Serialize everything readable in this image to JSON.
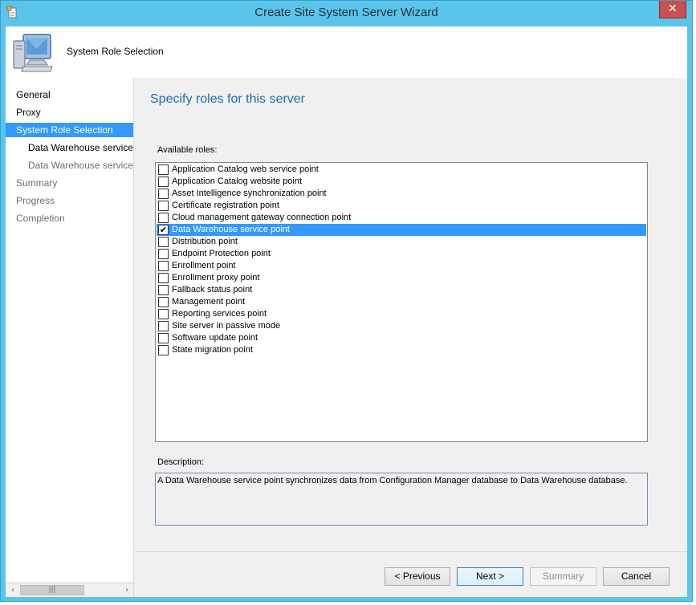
{
  "window": {
    "title": "Create Site System Server Wizard",
    "close_label": "✕"
  },
  "header": {
    "title": "System Role Selection"
  },
  "nav": {
    "items": [
      {
        "label": "General",
        "state": "normal"
      },
      {
        "label": "Proxy",
        "state": "normal"
      },
      {
        "label": "System Role Selection",
        "state": "active"
      },
      {
        "label": "Data Warehouse service point",
        "state": "sub"
      },
      {
        "label": "Data Warehouse service point",
        "state": "sub-disabled"
      },
      {
        "label": "Summary",
        "state": "disabled"
      },
      {
        "label": "Progress",
        "state": "disabled"
      },
      {
        "label": "Completion",
        "state": "disabled"
      }
    ],
    "scroll_left": "‹",
    "scroll_right": "›",
    "scroll_grip": "|||"
  },
  "main": {
    "page_title": "Specify roles for this server",
    "available_roles_label": "Available roles:",
    "roles": [
      {
        "label": "Application Catalog web service point",
        "checked": false
      },
      {
        "label": "Application Catalog website point",
        "checked": false
      },
      {
        "label": "Asset Intelligence synchronization point",
        "checked": false
      },
      {
        "label": "Certificate registration point",
        "checked": false
      },
      {
        "label": "Cloud management gateway connection point",
        "checked": false
      },
      {
        "label": "Data Warehouse service point",
        "checked": true,
        "selected": true
      },
      {
        "label": "Distribution point",
        "checked": false
      },
      {
        "label": "Endpoint Protection point",
        "checked": false
      },
      {
        "label": "Enrollment point",
        "checked": false
      },
      {
        "label": "Enrollment proxy point",
        "checked": false
      },
      {
        "label": "Fallback status point",
        "checked": false
      },
      {
        "label": "Management point",
        "checked": false
      },
      {
        "label": "Reporting services point",
        "checked": false
      },
      {
        "label": "Site server in passive mode",
        "checked": false
      },
      {
        "label": "Software update point",
        "checked": false
      },
      {
        "label": "State migration point",
        "checked": false
      }
    ],
    "description_label": "Description:",
    "description_text": "A Data Warehouse service point synchronizes data from Configuration Manager database to Data Warehouse database."
  },
  "buttons": {
    "previous": "< Previous",
    "next": "Next >",
    "summary": "Summary",
    "cancel": "Cancel"
  },
  "checkmark": "✔",
  "colors": {
    "accent": "#3399ff",
    "title_bar": "#5bc4ea",
    "page_title": "#1f6bb6",
    "close": "#c75050"
  }
}
